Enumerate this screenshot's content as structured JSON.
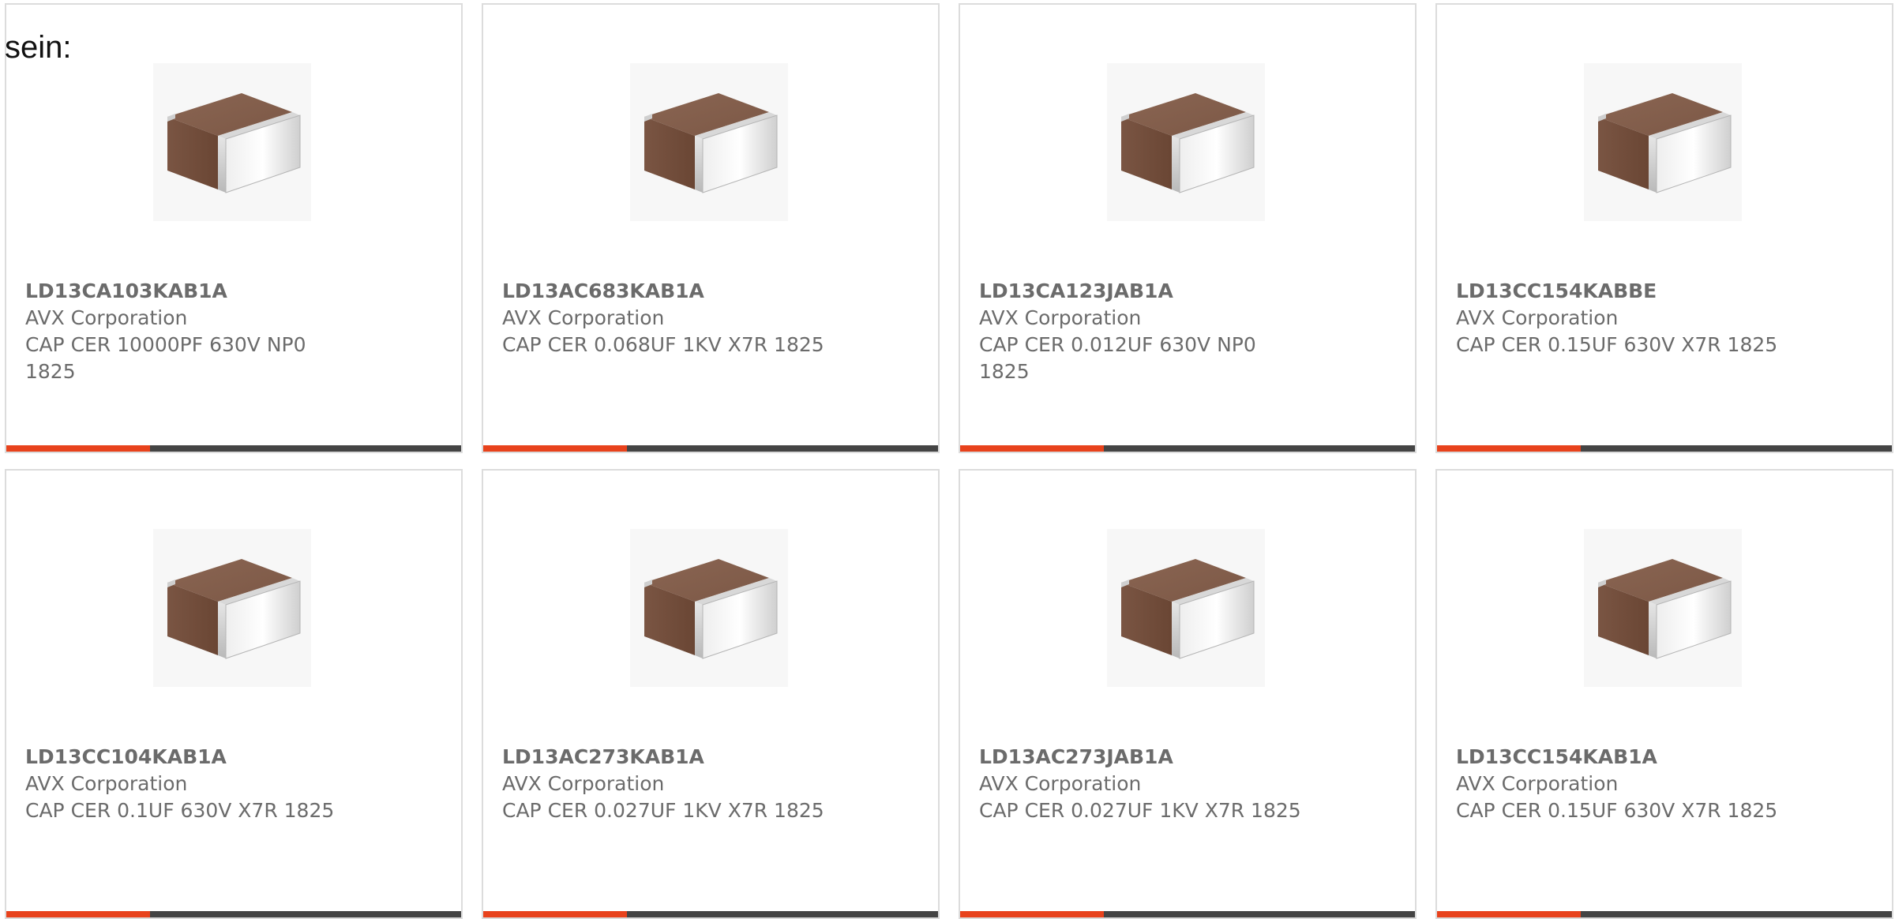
{
  "page_label": "sein:",
  "colors": {
    "accent": "#e8421c",
    "bar": "#444444",
    "text": "#6b6b6b",
    "border": "#dcdcdc"
  },
  "product_icon": "capacitor-chip-icon",
  "products": [
    {
      "part_number": "LD13CA103KAB1A",
      "manufacturer": "AVX Corporation",
      "description": "CAP CER 10000PF 630V NP0 1825"
    },
    {
      "part_number": "LD13AC683KAB1A",
      "manufacturer": "AVX Corporation",
      "description": "CAP CER 0.068UF 1KV X7R 1825"
    },
    {
      "part_number": "LD13CA123JAB1A",
      "manufacturer": "AVX Corporation",
      "description": "CAP CER 0.012UF 630V NP0 1825"
    },
    {
      "part_number": "LD13CC154KABBE",
      "manufacturer": "AVX Corporation",
      "description": "CAP CER 0.15UF 630V X7R 1825"
    },
    {
      "part_number": "LD13CC104KAB1A",
      "manufacturer": "AVX Corporation",
      "description": "CAP CER 0.1UF 630V X7R 1825"
    },
    {
      "part_number": "LD13AC273KAB1A",
      "manufacturer": "AVX Corporation",
      "description": "CAP CER 0.027UF 1KV X7R 1825"
    },
    {
      "part_number": "LD13AC273JAB1A",
      "manufacturer": "AVX Corporation",
      "description": "CAP CER 0.027UF 1KV X7R 1825"
    },
    {
      "part_number": "LD13CC154KAB1A",
      "manufacturer": "AVX Corporation",
      "description": "CAP CER 0.15UF 630V X7R 1825"
    }
  ]
}
